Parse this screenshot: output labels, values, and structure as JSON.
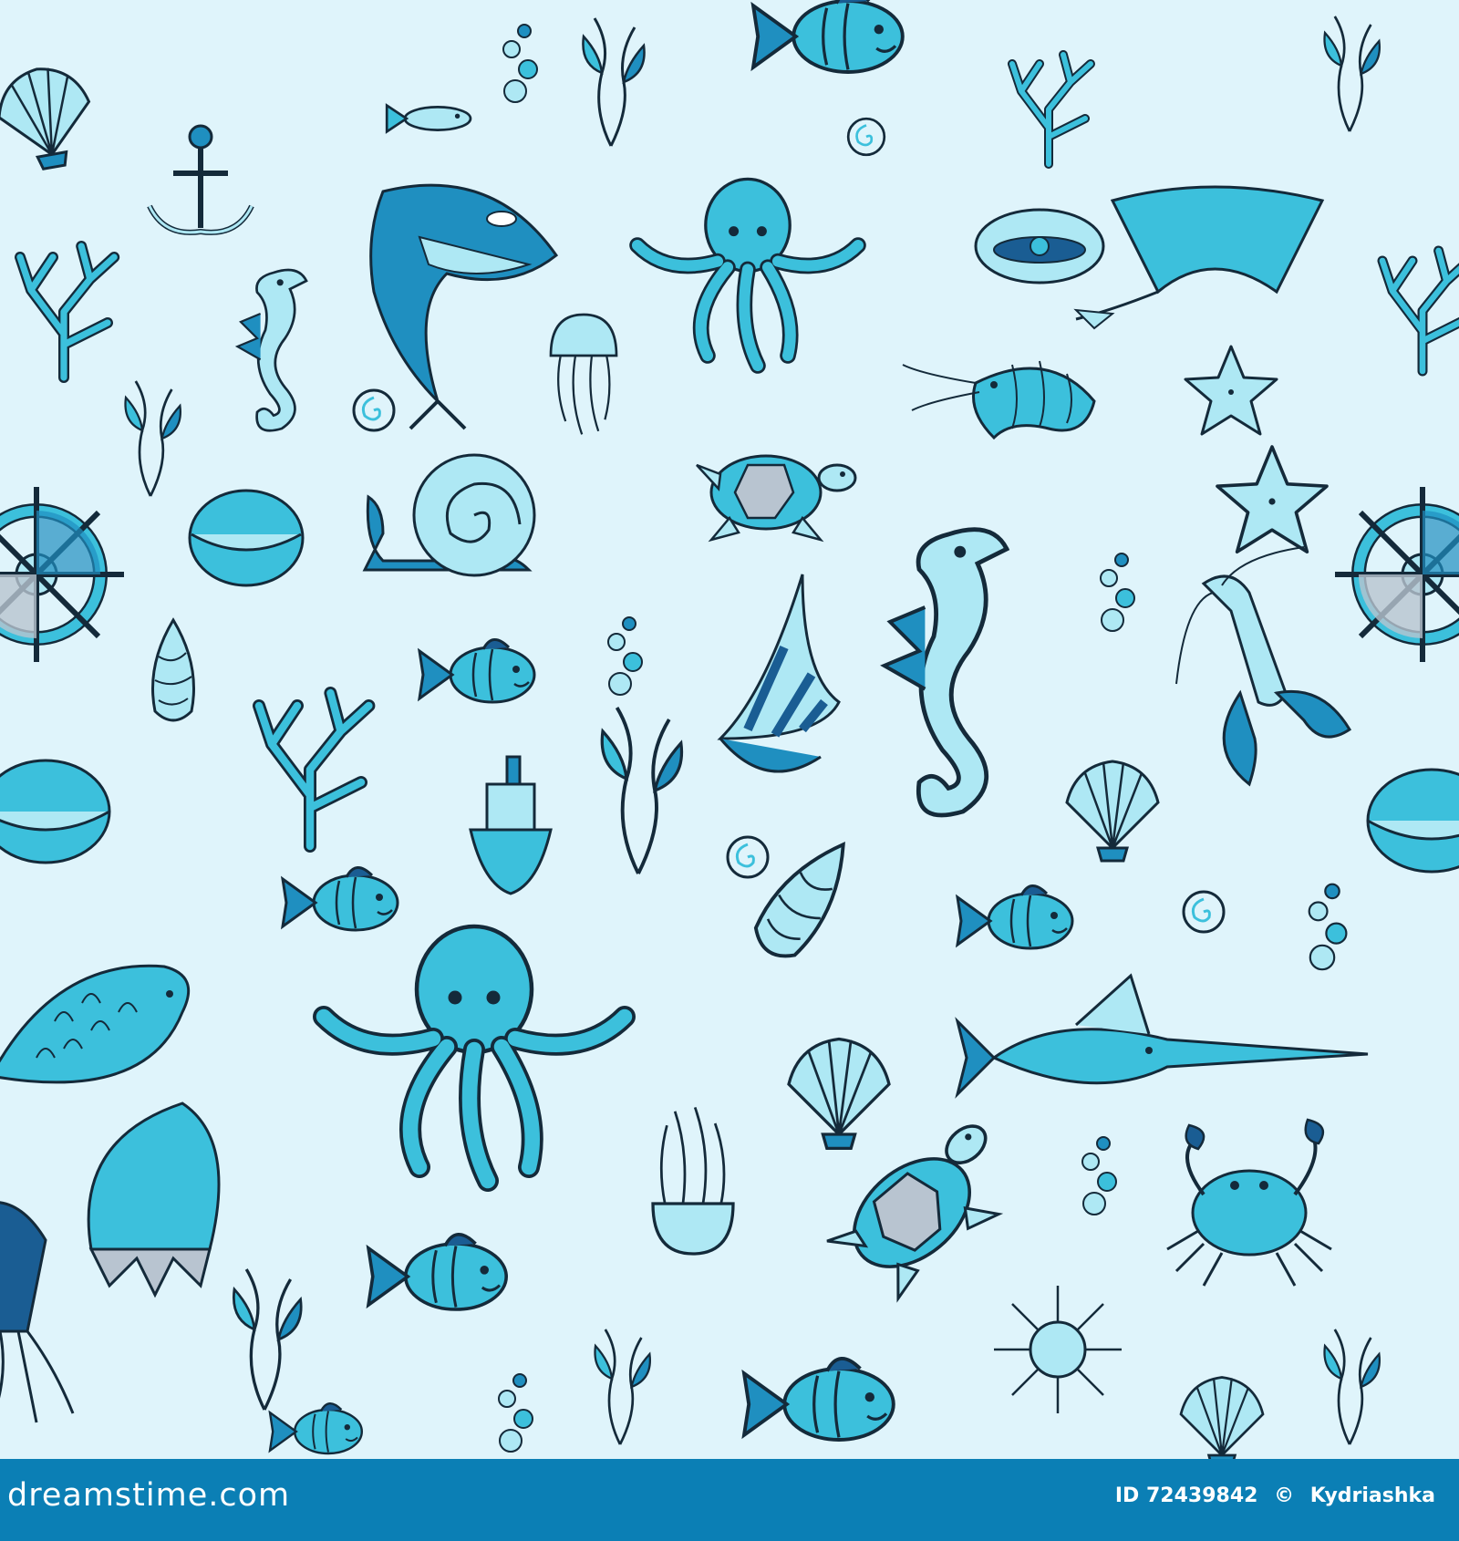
{
  "image": {
    "subject": "pattern",
    "palette": {
      "background": "#dff4fb",
      "light": "#aee8f4",
      "mid": "#3cc0dc",
      "deep": "#1f8fc0",
      "navy": "#1a5d93",
      "grey": "#b8c4d0",
      "ink": "#142a3a",
      "footer": "#0b7fb5"
    },
    "icons": [
      "anchor-icon",
      "ship-wheel-icon",
      "seahorse-icon",
      "orca-icon",
      "octopus-icon",
      "jellyfish-icon",
      "stingray-icon",
      "shrimp-icon",
      "lobster-icon",
      "crab-icon",
      "turtle-icon",
      "starfish-icon",
      "fish-icon",
      "swordfish-icon",
      "scallop-shell-icon",
      "snail-icon",
      "coral-icon",
      "seaweed-icon",
      "bubbles-icon",
      "sea-urchin-icon",
      "boat-icon"
    ]
  },
  "footer": {
    "logo_text": "dreamstime.com",
    "id_text": "ID 72439842",
    "copyright_symbol": "©",
    "author": "Kydriashka"
  }
}
